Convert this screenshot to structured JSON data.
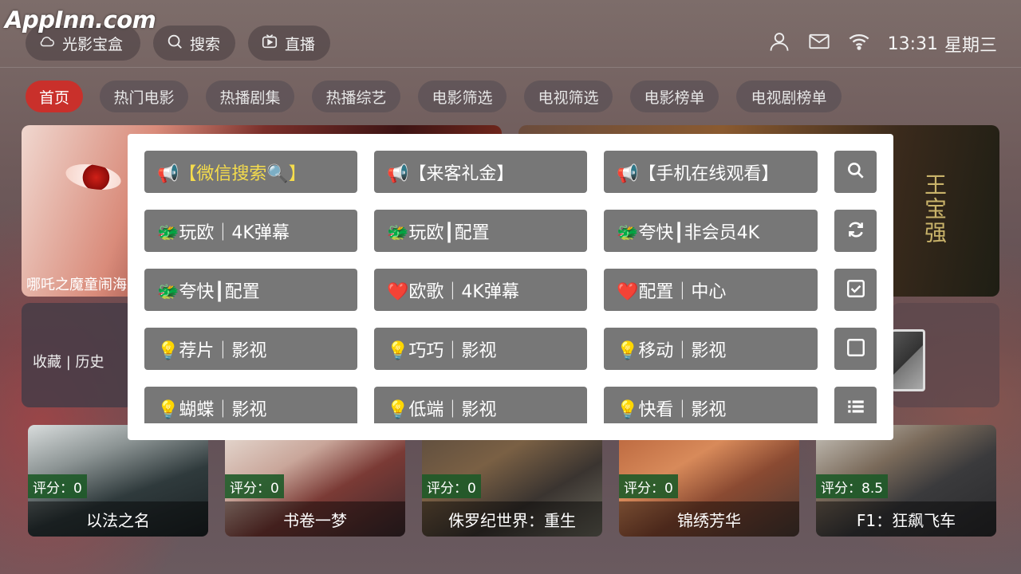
{
  "watermark": "AppInn.com",
  "topbar": {
    "left_pills": [
      {
        "label": "光影宝盒",
        "icon": "cloud-icon"
      },
      {
        "label": "搜索",
        "icon": "search-icon"
      },
      {
        "label": "直播",
        "icon": "live-tv-icon"
      }
    ],
    "time": "13:31",
    "weekday": "星期三"
  },
  "tabs": [
    "首页",
    "热门电影",
    "热播剧集",
    "热播综艺",
    "电影筛选",
    "电视筛选",
    "电影榜单",
    "电视剧榜单"
  ],
  "active_tab": "首页",
  "hero": {
    "left_title": "哪吒之魔童闹海",
    "right_calligraphy": "王宝强"
  },
  "favorites_label": "收藏 | 历史",
  "popup": {
    "rows": [
      [
        "📢【微信搜索🔍】",
        "📢【来客礼金】",
        "📢【手机在线观看】"
      ],
      [
        "🐲玩欧｜4K弹幕",
        "🐲玩欧┃配置",
        "🐲夸快┃非会员4K"
      ],
      [
        "🐲夸快┃配置",
        "❤️欧歌｜4K弹幕",
        "❤️配置｜中心"
      ],
      [
        "💡荐片｜影视",
        "💡巧巧｜影视",
        "💡移动｜影视"
      ],
      [
        "💡蝴蝶｜影视",
        "💡低端｜影视",
        "💡快看｜影视"
      ]
    ],
    "side_icons": [
      "search-icon",
      "refresh-icon",
      "checkbox-checked-icon",
      "checkbox-empty-icon",
      "list-icon"
    ],
    "highlight_color": "#f5dc4c"
  },
  "movies": [
    {
      "title": "以法之名",
      "score": "评分：0"
    },
    {
      "title": "书卷一梦",
      "score": "评分：0"
    },
    {
      "title": "侏罗纪世界：重生",
      "score": "评分：0"
    },
    {
      "title": "锦绣芳华",
      "score": "评分：0"
    },
    {
      "title": "F1：狂飙飞车",
      "score": "评分：8.5"
    }
  ],
  "colors": {
    "accent": "#c9302b",
    "popup_button": "#777777",
    "score_badge": "#1e5a28"
  }
}
